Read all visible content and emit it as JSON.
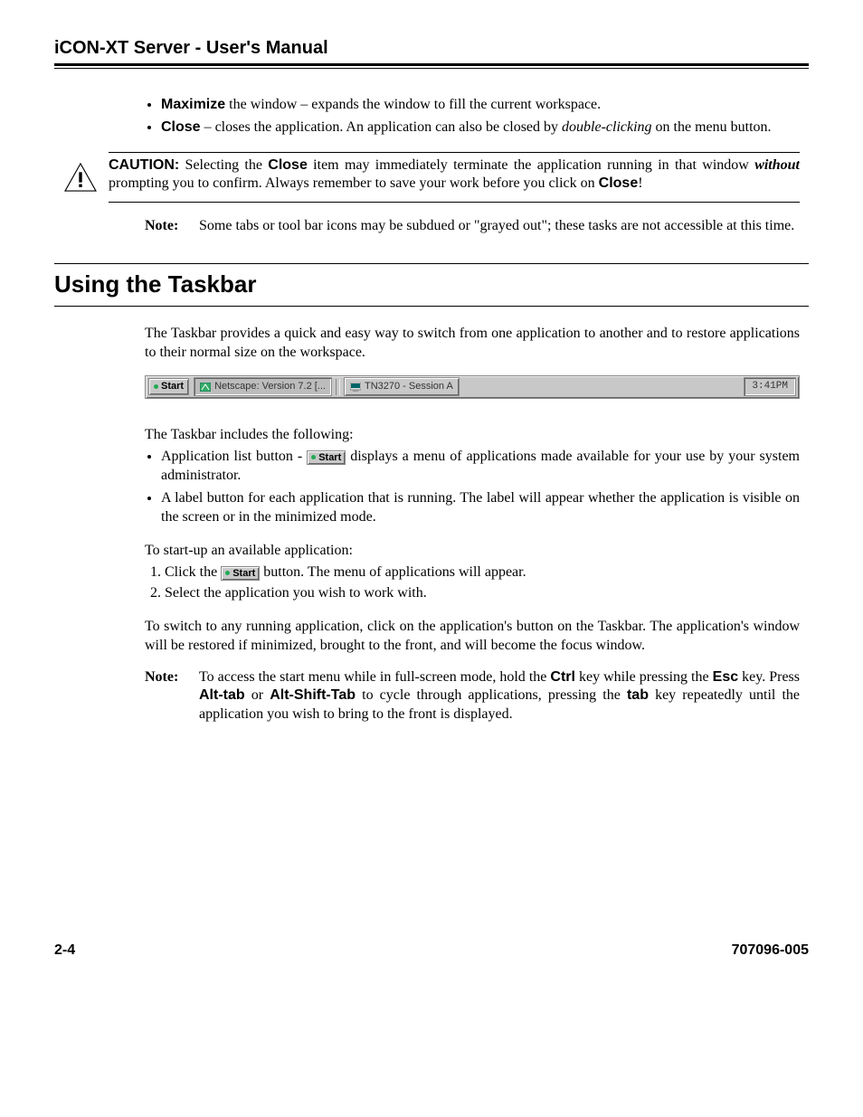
{
  "header": {
    "title": "iCON-XT Server - User's Manual"
  },
  "bullets_top": {
    "maximize": {
      "label": "Maximize",
      "rest": " the window – expands the window to fill the current workspace."
    },
    "close": {
      "label": "Close",
      "mid": " – closes the application. An application can also be closed by ",
      "italic": "double-clicking",
      "rest": " on the menu button."
    }
  },
  "caution": {
    "label": "CAUTION:",
    "p1": "  Selecting the ",
    "close1": "Close",
    "p2": " item may immediately terminate the application running in that window ",
    "without": "without",
    "p3": " prompting you to confirm. Always remember to save your work before you click on ",
    "close2": "Close",
    "p4": "!"
  },
  "note1": {
    "label": "Note:",
    "body": "Some tabs or tool bar icons may be subdued or \"grayed out\"; these tasks are not accessible at this time."
  },
  "section": {
    "title": "Using the Taskbar"
  },
  "intro": "The Taskbar provides a quick and easy way to switch from one application to another and to restore applications to their normal size on the workspace.",
  "taskbar": {
    "start": "Start",
    "app1": "Netscape: Version 7.2   [...",
    "app2": "TN3270 - Session A",
    "clock": "3:41PM"
  },
  "includes_intro": "The Taskbar includes the following:",
  "includes": {
    "b1a": "Application list button -  ",
    "b1b": " displays a menu of applications made available for your use by your system administrator.",
    "b2": "A label button for each application that is running. The label will appear whether the application is visible on the screen or in the minimized mode."
  },
  "startup_intro": "To start-up an available application:",
  "steps": {
    "s1a": "Click the ",
    "s1b": " button. The menu of applications will appear.",
    "s2": "Select the application you wish to work with."
  },
  "switch": "To switch to any running application, click on the application's button on the Taskbar. The application's window will be restored if minimized, brought to the front, and will become the focus window.",
  "note2": {
    "label": "Note:",
    "a": "To access the start menu while in full-screen mode, hold the ",
    "ctrl": "Ctrl",
    "b": " key while pressing the ",
    "esc": "Esc",
    "c": " key. Press ",
    "alttab": "Alt-tab",
    "d": " or ",
    "altshifttab": "Alt-Shift-Tab",
    "e": " to cycle through applications, pressing the ",
    "tab": "tab",
    "f": " key repeatedly until the application you wish to bring to the front is displayed."
  },
  "footer": {
    "page": "2-4",
    "docnum": "707096-005"
  },
  "inline_start_label": "Start"
}
